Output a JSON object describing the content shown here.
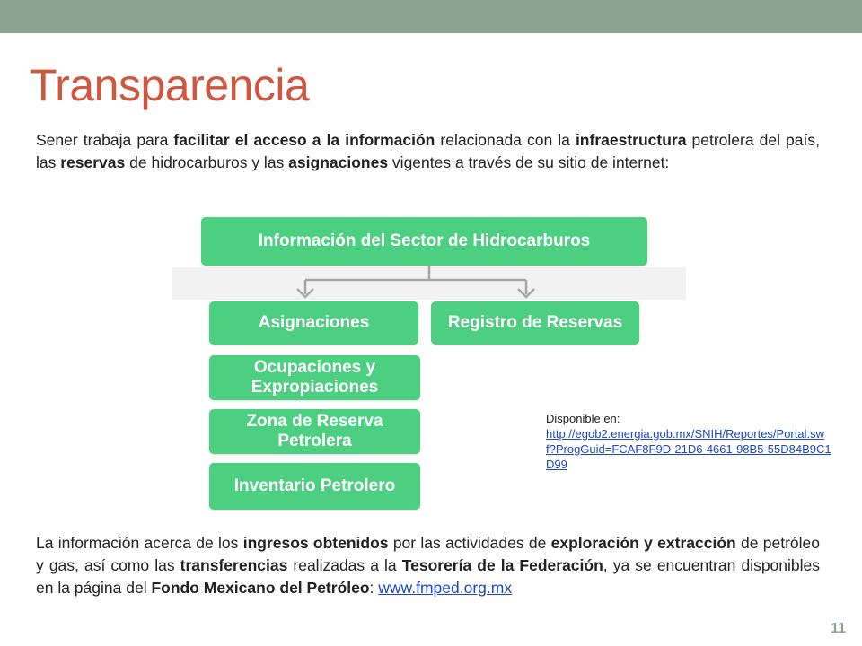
{
  "slide": {
    "title": "Transparencia",
    "page_number": "11",
    "accent_color": "#8fa292",
    "title_color": "#d0573f"
  },
  "intro": [
    {
      "t": "Sener trabaja para ",
      "b": false
    },
    {
      "t": "facilitar el acceso a la información",
      "b": true
    },
    {
      "t": " relacionada con la ",
      "b": false
    },
    {
      "t": "infraestructura",
      "b": true
    },
    {
      "t": " petrolera del país, las ",
      "b": false
    },
    {
      "t": "reservas",
      "b": true
    },
    {
      "t": " de hidrocarburos y las ",
      "b": false
    },
    {
      "t": "asignaciones",
      "b": true
    },
    {
      "t": " vigentes a través de su sitio de internet:",
      "b": false
    }
  ],
  "diagram": {
    "box_color": "#4dcf82",
    "root": "Información del Sector de Hidrocarburos",
    "branch_left": "Asignaciones",
    "branch_right": "Registro de Reservas",
    "sub_items": [
      "Ocupaciones y Expropiaciones",
      "Zona de Reserva Petrolera",
      "Inventario Petrolero"
    ]
  },
  "source": {
    "label": "Disponible en:",
    "url": "http://egob2.energia.gob.mx/SNIH/Reportes/Portal.swf?ProgGuid=FCAF8F9D-21D6-4661-98B5-55D84B9C1D99"
  },
  "closing": [
    {
      "t": "La información acerca de los ",
      "b": false
    },
    {
      "t": "ingresos obtenidos",
      "b": true
    },
    {
      "t": " por las actividades de ",
      "b": false
    },
    {
      "t": "exploración y extracción",
      "b": true
    },
    {
      "t": " de petróleo y gas, así como las ",
      "b": false
    },
    {
      "t": "transferencias",
      "b": true
    },
    {
      "t": " realizadas a la ",
      "b": false
    },
    {
      "t": "Tesorería de la Federación",
      "b": true
    },
    {
      "t": ", ya se encuentran disponibles en la página del ",
      "b": false
    },
    {
      "t": "Fondo Mexicano del Petróleo",
      "b": true
    },
    {
      "t": ": ",
      "b": false
    }
  ],
  "closing_link": "www.fmped.org.mx"
}
